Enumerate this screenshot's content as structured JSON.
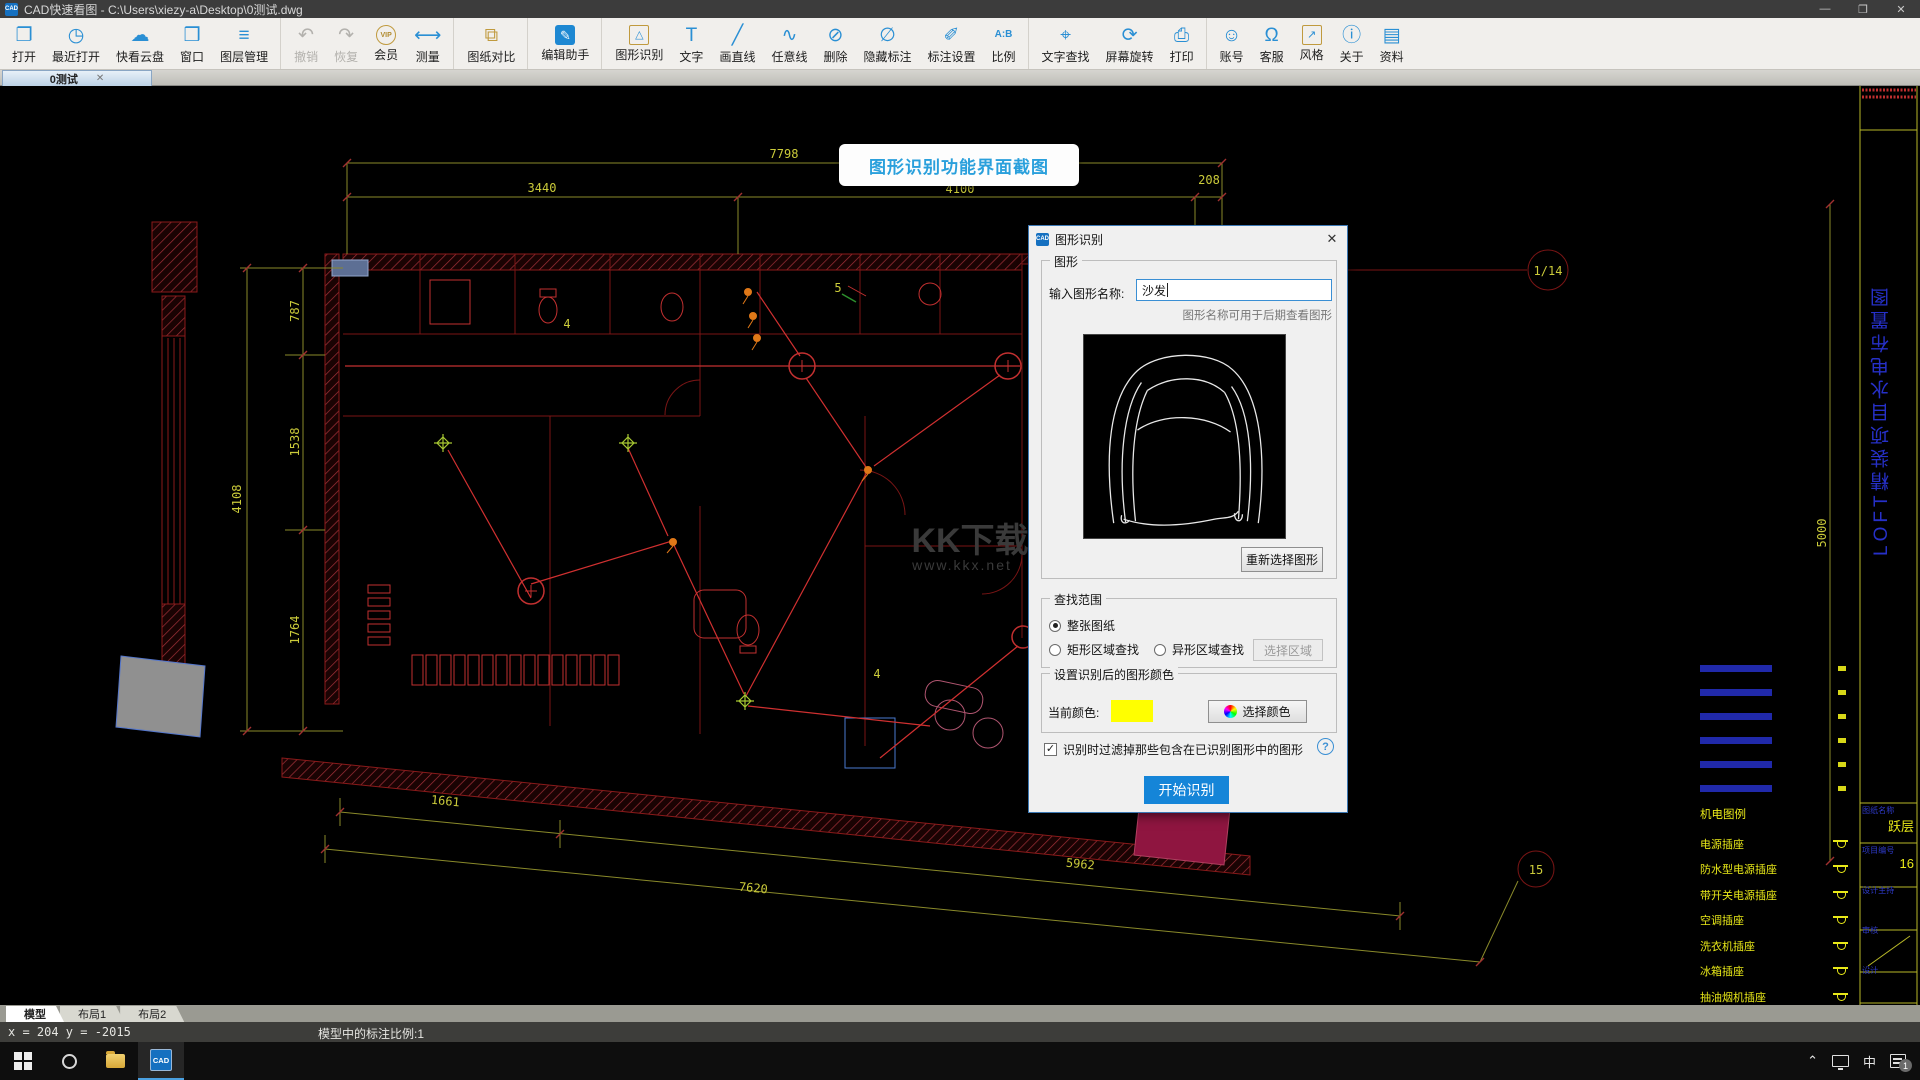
{
  "window": {
    "title": "CAD快速看图 - C:\\Users\\xiezy-a\\Desktop\\0测试.dwg",
    "controls": {
      "minimize": "—",
      "maximize": "❐",
      "close": "✕"
    }
  },
  "toolbar": {
    "items": [
      {
        "name": "open",
        "label": "打开",
        "glyph": "❐"
      },
      {
        "name": "recent-open",
        "label": "最近打开",
        "glyph": "◷"
      },
      {
        "name": "cloud-disk",
        "label": "快看云盘",
        "glyph": "☁"
      },
      {
        "name": "window",
        "label": "窗口",
        "glyph": "❒"
      },
      {
        "name": "layer-manager",
        "label": "图层管理",
        "glyph": "≡",
        "sep": true
      },
      {
        "name": "undo",
        "label": "撤销",
        "glyph": "↶",
        "disabled": true
      },
      {
        "name": "redo",
        "label": "恢复",
        "glyph": "↷",
        "disabled": true
      },
      {
        "name": "vip",
        "label": "会员",
        "glyph": "VIP",
        "vip": true
      },
      {
        "name": "measure",
        "label": "测量",
        "glyph": "⟷",
        "sep": true
      },
      {
        "name": "drawing-compare",
        "label": "图纸对比",
        "glyph": "⧉",
        "gold": true,
        "sep": true
      },
      {
        "name": "edit-assistant",
        "label": "编辑助手",
        "glyph": "✎",
        "chip": true,
        "sep": true
      },
      {
        "name": "shape-recognition",
        "label": "图形识别",
        "glyph": "△",
        "frame": true
      },
      {
        "name": "text",
        "label": "文字",
        "glyph": "T"
      },
      {
        "name": "draw-line",
        "label": "画直线",
        "glyph": "╱"
      },
      {
        "name": "free-line",
        "label": "任意线",
        "glyph": "∿"
      },
      {
        "name": "delete",
        "label": "删除",
        "glyph": "⊘"
      },
      {
        "name": "hide-annotation",
        "label": "隐藏标注",
        "glyph": "∅"
      },
      {
        "name": "annotation-settings",
        "label": "标注设置",
        "glyph": "✐"
      },
      {
        "name": "scale",
        "label": "比例",
        "glyph": "A:B",
        "smalltext": true,
        "sep": true
      },
      {
        "name": "text-search",
        "label": "文字查找",
        "glyph": "⌖"
      },
      {
        "name": "screen-rotate",
        "label": "屏幕旋转",
        "glyph": "⟳"
      },
      {
        "name": "print",
        "label": "打印",
        "glyph": "⎙",
        "sep": true
      },
      {
        "name": "account",
        "label": "账号",
        "glyph": "☺"
      },
      {
        "name": "support",
        "label": "客服",
        "glyph": "Ω"
      },
      {
        "name": "style",
        "label": "风格",
        "glyph": "↗",
        "frame": true
      },
      {
        "name": "about",
        "label": "关于",
        "glyph": "ⓘ"
      },
      {
        "name": "materials",
        "label": "资料",
        "glyph": "▤"
      }
    ]
  },
  "doc_tab": {
    "label": "0测试",
    "close": "✕"
  },
  "banner": {
    "text": "图形识别功能界面截图"
  },
  "drawing": {
    "dims": {
      "d7798": "7798",
      "d3440": "3440",
      "d208": "208",
      "d4100": "4100",
      "d787": "787",
      "d1538": "1538",
      "d1764": "1764",
      "d4108": "4108",
      "d1661": "1661",
      "d5962": "5962",
      "d7620": "7620",
      "d5000": "5000",
      "bubble_top": "1/14",
      "bubble_bottom": "15",
      "n5": "5",
      "n4a": "4",
      "n4b": "4"
    },
    "watermark": {
      "line1": "KK下载",
      "line2": "www.kkx.net"
    },
    "titleblock": {
      "vertical_text": "LOFT精装项目水电布置图",
      "fields": [
        {
          "label": "图纸名称",
          "value": "跃层"
        },
        {
          "label": "项目编号",
          "value": "16"
        },
        {
          "label": "设计主持",
          "value": ""
        },
        {
          "label": "审核",
          "value": ""
        },
        {
          "label": "设计",
          "value": ""
        }
      ]
    },
    "legend": {
      "title": "机电图例",
      "items": [
        {
          "label": "电源插座"
        },
        {
          "label": "防水型电源插座"
        },
        {
          "label": "带开关电源插座"
        },
        {
          "label": "空调插座"
        },
        {
          "label": "洗衣机插座"
        },
        {
          "label": "冰箱插座"
        },
        {
          "label": "抽油烟机插座"
        }
      ]
    }
  },
  "dialog": {
    "title": "图形识别",
    "close": "✕",
    "group_shape": "图形",
    "name_label": "输入图形名称:",
    "name_value": "沙发",
    "hint": "图形名称可用于后期查看图形",
    "reselect": "重新选择图形",
    "group_range": "查找范围",
    "radio_whole": "整张图纸",
    "radio_rect": "矩形区域查找",
    "radio_poly": "异形区域查找",
    "select_area": "选择区域",
    "group_color": "设置识别后的图形颜色",
    "current_color_label": "当前颜色:",
    "current_color": "#ffff00",
    "pick_color": "选择颜色",
    "filter_label": "识别时过滤掉那些包含在已识别图形中的图形",
    "help": "?",
    "start": "开始识别"
  },
  "sheet_tabs": [
    {
      "name": "model",
      "label": "模型",
      "active": true
    },
    {
      "name": "layout1",
      "label": "布局1"
    },
    {
      "name": "layout2",
      "label": "布局2"
    }
  ],
  "status": {
    "coords": "x = 204 y = -2015",
    "scale_label": "模型中的标注比例:1"
  },
  "taskbar": {
    "ime": "中",
    "badge": "1"
  },
  "colors": {
    "accent": "#1585d8",
    "dim_line": "#8a8a2a",
    "dim_text": "#cbcb3a",
    "wall_red": "#7a1515",
    "bright_red": "#c23030",
    "legend_yellow": "#e8e818",
    "blueprint_blue": "#2630c8",
    "swatch_yellow": "#ffff00"
  }
}
